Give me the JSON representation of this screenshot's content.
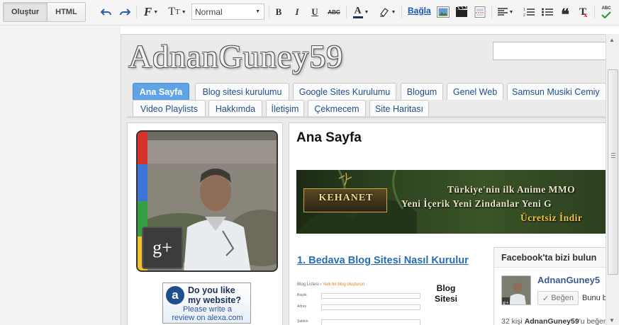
{
  "toolbar": {
    "modes": [
      {
        "label": "Oluştur",
        "active": true
      },
      {
        "label": "HTML",
        "active": false
      }
    ],
    "undo_icon": "undo-icon",
    "redo_icon": "redo-icon",
    "font_icon": "font-family-icon",
    "text_size_icon": "text-size-icon",
    "paragraph_format": "Normal",
    "bold": "B",
    "italic": "I",
    "underline": "U",
    "strikethrough": "ABC",
    "text_color_icon": "text-color-icon",
    "highlight_icon": "highlight-icon",
    "link_label": "Bağla",
    "image_icon": "insert-image-icon",
    "video_icon": "insert-video-icon",
    "jump_break_icon": "jump-break-icon",
    "align_icon": "align-icon",
    "numbered_list_icon": "numbered-list-icon",
    "bullet_list_icon": "bullet-list-icon",
    "quote_icon": "quote-icon",
    "clear_format_icon": "remove-formatting-icon",
    "spellcheck": "ABC"
  },
  "site": {
    "title": "AdnanGuney59",
    "search_value": ""
  },
  "tabs": [
    {
      "label": "Ana Sayfa",
      "active": true
    },
    {
      "label": "Blog sitesi kurulumu",
      "active": false
    },
    {
      "label": "Google Sites Kurulumu",
      "active": false
    },
    {
      "label": "Blogum",
      "active": false
    },
    {
      "label": "Genel Web",
      "active": false
    },
    {
      "label": "Samsun Musiki Cemiy",
      "active": false
    },
    {
      "label": "Video Playlists",
      "active": false
    },
    {
      "label": "Hakkımda",
      "active": false
    },
    {
      "label": "İletişim",
      "active": false
    },
    {
      "label": "Çekmecem",
      "active": false
    },
    {
      "label": "Site Haritası",
      "active": false
    }
  ],
  "sidebar": {
    "gplus_badge": "g+",
    "alexa": {
      "logo": "a",
      "line1": "Do you like",
      "line2": "my website?",
      "line3": "Please write a",
      "line4": "review on alexa.com"
    }
  },
  "main": {
    "page_title": "Ana Sayfa",
    "banner": {
      "logo_text": "KEHANET",
      "line1": "Türkiye'nin ilk Anime MMO",
      "line2": "Yeni İçerik Yeni Zindanlar Yeni G",
      "line3": "Ücretsiz İndir"
    },
    "post_link": "1. Bedava Blog Sitesi Nasıl Kurulur",
    "post_thumb": {
      "crumb": "Blog Listesi",
      "crumb_sep": " › ",
      "crumb_current": "Yeni bir blog oluşturun",
      "row1": "Başlık",
      "row2": "Adres",
      "row3": "Şablon"
    },
    "post_caption_line1": "Blog",
    "post_caption_line2": "Sitesi"
  },
  "facebook": {
    "title": "Facebook'ta bizi bulun",
    "page_name": "AdnanGuney5",
    "like_label": "Beğen",
    "like_count_text": "Bunu b",
    "footer_count": "32 kişi",
    "footer_name": "AdnanGuney59",
    "footer_rest": "'u beğeniyor."
  }
}
